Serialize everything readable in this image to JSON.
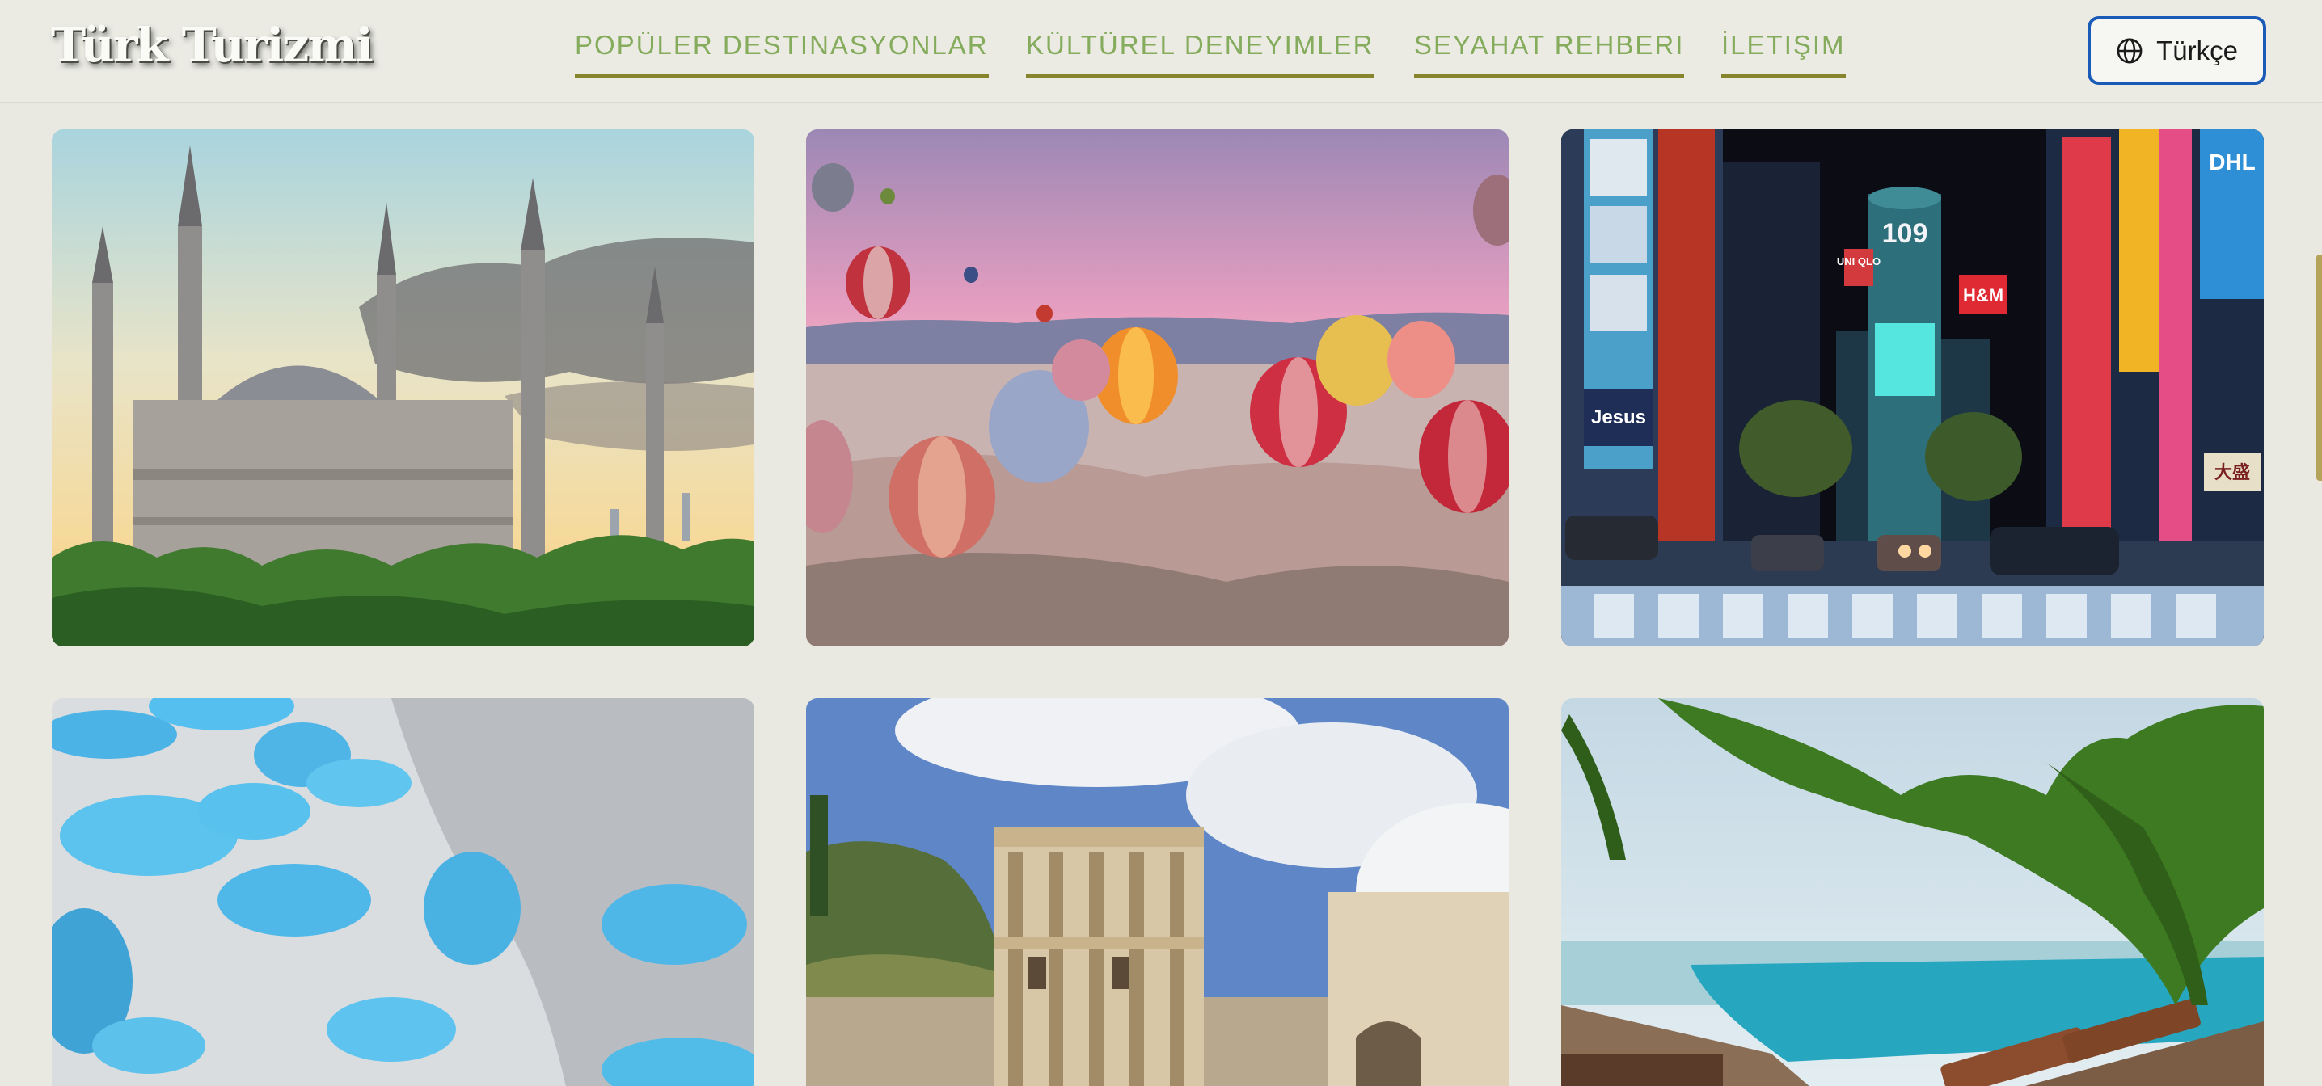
{
  "header": {
    "logo_text": "Türk Turizmi",
    "nav": [
      {
        "label": "POPÜLER DESTINASYONLAR"
      },
      {
        "label": "KÜLTÜREL DENEYIMLER"
      },
      {
        "label": "SEYAHAT REHBERI"
      },
      {
        "label": "İLETIŞIM"
      }
    ],
    "language": {
      "label": "Türkçe",
      "icon": "globe-icon"
    }
  },
  "colors": {
    "background": "#e9e9e2",
    "nav_text": "#85ac5c",
    "nav_underline": "#87852b",
    "language_border": "#1a5bb8",
    "scrollbar": "#b6a35a"
  },
  "gallery": {
    "cards": [
      {
        "subject": "Blue Mosque at sunset"
      },
      {
        "subject": "Cappadocia hot air balloons"
      },
      {
        "subject": "Neon city street at night"
      },
      {
        "subject": "Pamukkale travertine terraces"
      },
      {
        "subject": "Library of Celsus, Ephesus"
      },
      {
        "subject": "Seaside resort infinity pool"
      }
    ],
    "city_signs": [
      "Jesus",
      "UNI QLO",
      "H&M",
      "109",
      "DHL",
      "大盛"
    ]
  }
}
